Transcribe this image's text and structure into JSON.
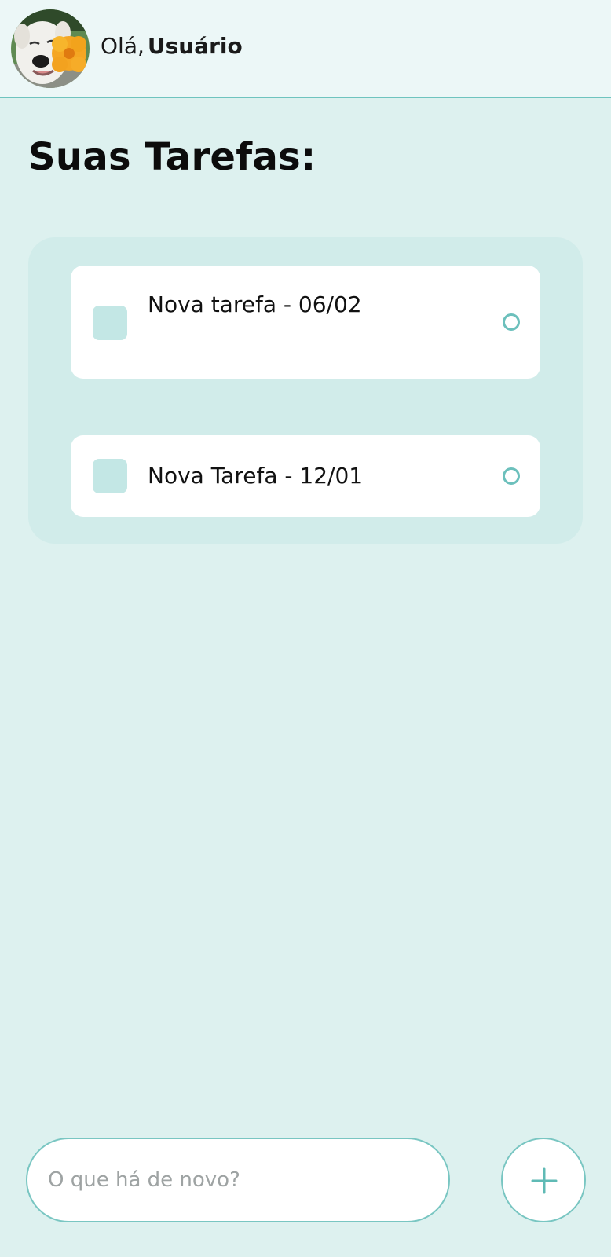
{
  "header": {
    "greeting_prefix": "Olá,",
    "user_name": "Usuário"
  },
  "main": {
    "title": "Suas Tarefas:",
    "tasks": [
      {
        "label": "Nova tarefa - 06/02",
        "completed": false
      },
      {
        "label": "Nova Tarefa - 12/01",
        "completed": false
      }
    ]
  },
  "composer": {
    "placeholder": "O que há de novo?",
    "value": ""
  },
  "icons": {
    "add": "plus-icon",
    "task_status": "circle-icon"
  },
  "colors": {
    "accent": "#6fc4bf",
    "background": "#ddf1ef",
    "panel": "#d1ecea",
    "checkbox": "#c3e7e5"
  }
}
